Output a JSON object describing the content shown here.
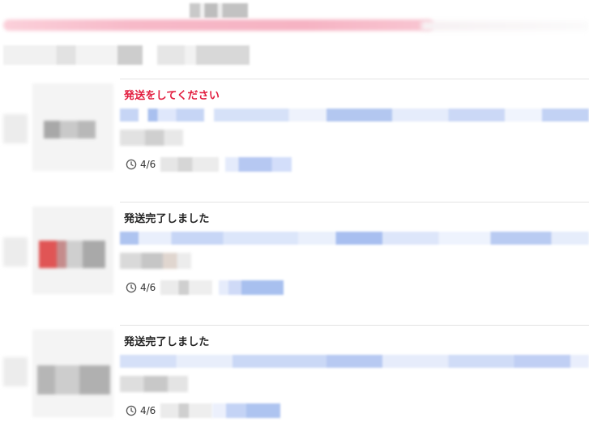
{
  "notifications": [
    {
      "title": "発送をしてください",
      "date": "4/6",
      "status": "alert"
    },
    {
      "title": "発送完了しました",
      "date": "4/6",
      "status": "done"
    },
    {
      "title": "発送完了しました",
      "date": "4/6",
      "status": "done"
    }
  ],
  "colors": {
    "alert_title": "#e21a3c",
    "normal_title": "#222222",
    "divider": "#e3e3e3",
    "link_blue": "#aec4f0",
    "header_pink": "#f7b9c8"
  },
  "icons": {
    "time": "clock-icon"
  }
}
